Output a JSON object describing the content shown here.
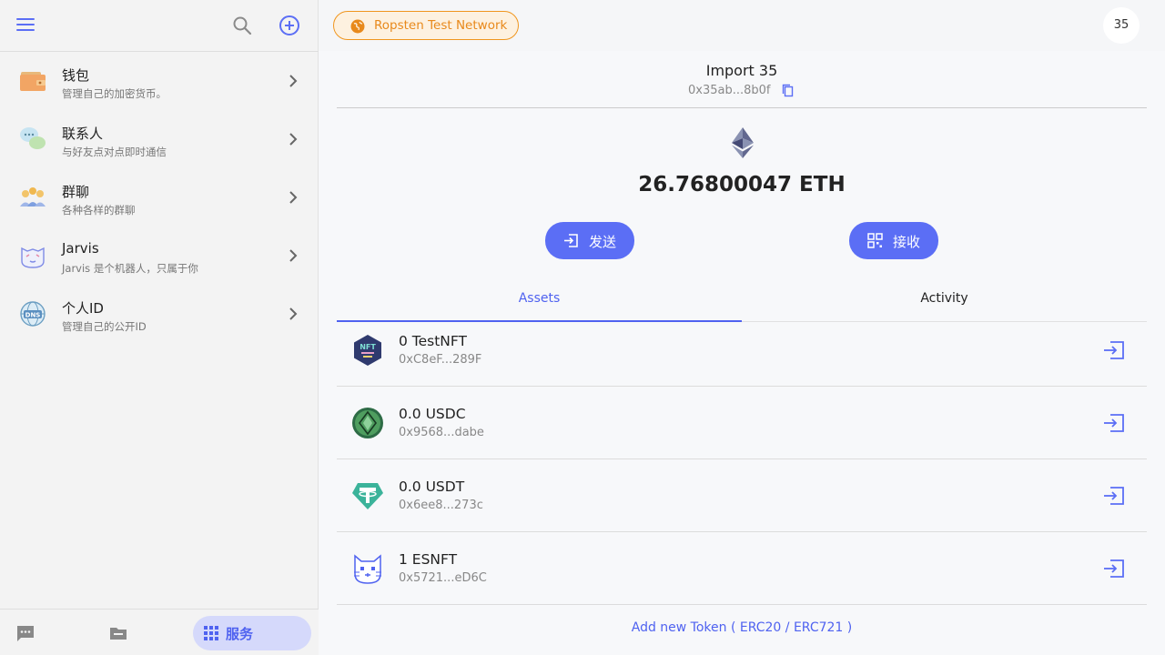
{
  "sidebar": {
    "items": [
      {
        "title": "钱包",
        "subtitle": "管理自己的加密货币。",
        "icon": "wallet-icon"
      },
      {
        "title": "联系人",
        "subtitle": "与好友点对点即时通信",
        "icon": "contacts-icon"
      },
      {
        "title": "群聊",
        "subtitle": "各种各样的群聊",
        "icon": "group-chat-icon"
      },
      {
        "title": "Jarvis",
        "subtitle": "Jarvis 是个机器人，只属于你",
        "icon": "jarvis-bot-icon"
      },
      {
        "title": "个人ID",
        "subtitle": "管理自己的公开ID",
        "icon": "dns-id-icon"
      }
    ],
    "footer": {
      "services_label": "服务"
    }
  },
  "header": {
    "network": "Ropsten Test Network",
    "avatar_text": "35"
  },
  "account": {
    "name": "Import 35",
    "address": "0x35ab...8b0f",
    "balance": "26.76800047 ETH",
    "send_label": "发送",
    "receive_label": "接收"
  },
  "tabs": [
    {
      "label": "Assets",
      "active": true
    },
    {
      "label": "Activity",
      "active": false
    }
  ],
  "assets": [
    {
      "name": "0 TestNFT",
      "address": "0xC8eF...289F"
    },
    {
      "name": "0.0 USDC",
      "address": "0x9568...dabe"
    },
    {
      "name": "0.0 USDT",
      "address": "0x6ee8...273c"
    },
    {
      "name": "1 ESNFT",
      "address": "0x5721...eD6C"
    }
  ],
  "add_token_label": "Add new Token ( ERC20 / ERC721 )",
  "colors": {
    "accent": "#5b6ef5",
    "network_orange": "#e8891b",
    "services_bg": "#d5d9fb"
  }
}
